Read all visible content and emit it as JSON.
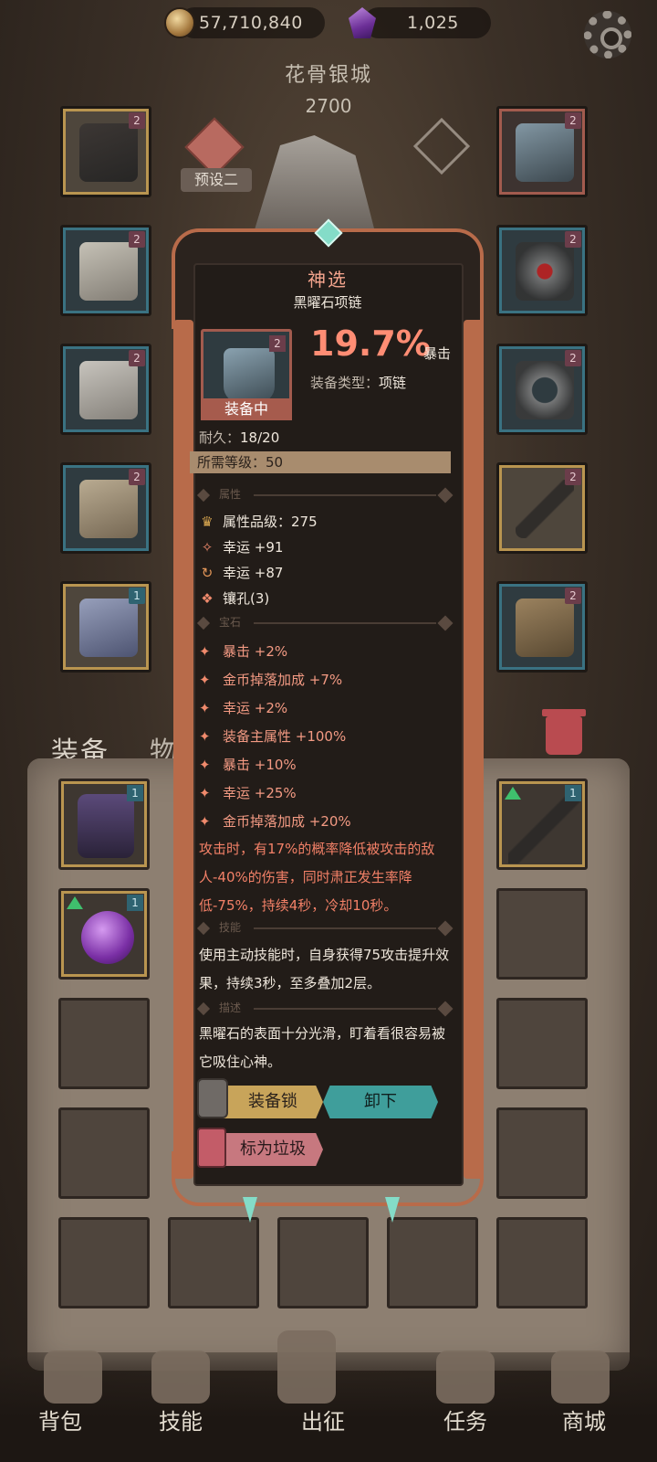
{
  "resources": {
    "gold": "57,710,840",
    "gems": "1,025"
  },
  "icons": {
    "gold": "coin-icon",
    "gems": "purple-crystal-icon",
    "settings": "gear-icon"
  },
  "character": {
    "name": "花骨银城",
    "power": "2700",
    "preset_label": "预设二"
  },
  "equipment_slots_left": [
    {
      "name": "helmet-slot",
      "level": "2"
    },
    {
      "name": "armor-slot",
      "level": "2"
    },
    {
      "name": "gloves-slot",
      "level": "2"
    },
    {
      "name": "pants-slot",
      "level": "2"
    },
    {
      "name": "boots-slot",
      "level": "1"
    }
  ],
  "equipment_slots_right": [
    {
      "name": "necklace-slot",
      "level": "2"
    },
    {
      "name": "ring-slot",
      "level": "2"
    },
    {
      "name": "bracelet-slot",
      "level": "2"
    },
    {
      "name": "weapon-slot",
      "level": "2"
    },
    {
      "name": "book-slot",
      "level": "2"
    }
  ],
  "tabs": {
    "equipment": "装备",
    "items": "物品"
  },
  "inventory": {
    "items": [
      {
        "name": "cage-item",
        "level": "1"
      },
      {
        "name": "wand-item",
        "level": "1"
      },
      {
        "name": "orb-item",
        "level": "1"
      }
    ]
  },
  "nav": {
    "backpack": "背包",
    "skills": "技能",
    "expedition": "出征",
    "quests": "任务",
    "shop": "商城"
  },
  "tooltip": {
    "rarity": "神选",
    "item_name": "黑曜石项链",
    "item_level": "2",
    "equipped_label": "装备中",
    "crit_value": "19.7%",
    "crit_label": "暴击",
    "type_label": "装备类型：",
    "type_value": "项链",
    "durability_label": "耐久：",
    "durability_value": "18/20",
    "required_level": "所需等级：50",
    "section_attributes": "属性",
    "attributes": [
      {
        "icon": "crown-icon",
        "text": "属性品级：275"
      },
      {
        "icon": "luck-icon",
        "text": "幸运 +91"
      },
      {
        "icon": "cycle-icon",
        "text": "幸运 +87"
      },
      {
        "icon": "socket-icon",
        "text": "镶孔(3)"
      }
    ],
    "section_gems": "宝石",
    "gems": [
      "暴击 +2%",
      "金币掉落加成 +7%",
      "幸运 +2%",
      "装备主属性 +100%",
      "暴击 +10%",
      "幸运 +25%",
      "金币掉落加成 +20%"
    ],
    "effect_text": "攻击时，有17%的概率降低被攻击的敌人-40%的伤害，同时肃正发生率降低-75%，持续4秒，冷却10秒。",
    "section_skill": "技能",
    "skill_text": "使用主动技能时，自身获得75攻击提升效果，持续3秒，至多叠加2层。",
    "section_desc": "描述",
    "desc_text": "黑曜石的表面十分光滑，盯着看很容易被它吸住心神。",
    "btn_lock": "装备锁",
    "btn_unequip": "卸下",
    "btn_junk": "标为垃圾"
  },
  "colors": {
    "accent": "#ff8d74",
    "frame": "#b86b4a",
    "teal": "#3f9e9b"
  }
}
